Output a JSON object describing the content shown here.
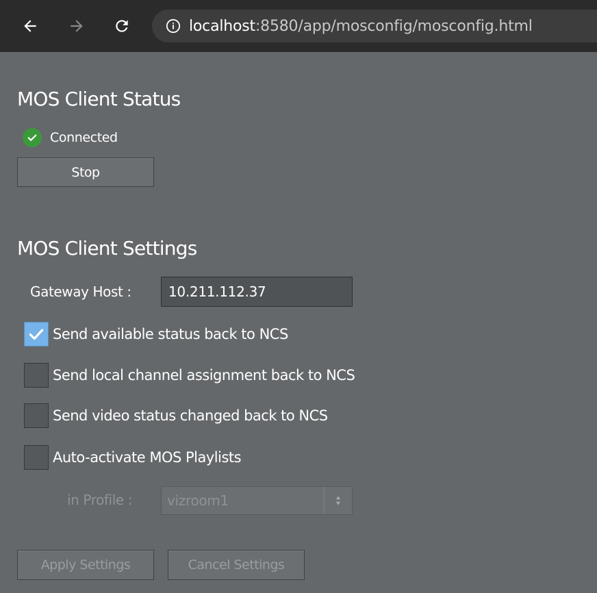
{
  "browser": {
    "url_host": "localhost",
    "url_rest": ":8580/app/mosconfig/mosconfig.html",
    "back_icon": "back-arrow-icon",
    "forward_icon": "forward-arrow-icon",
    "reload_icon": "reload-icon",
    "info_icon": "info-icon"
  },
  "status_section": {
    "title": "MOS Client Status",
    "status_text": "Connected",
    "status_color": "#3a9a3a",
    "stop_label": "Stop"
  },
  "settings_section": {
    "title": "MOS Client Settings",
    "gateway_label": "Gateway Host :",
    "gateway_value": "10.211.112.37",
    "options": [
      {
        "label": "Send available status back to NCS",
        "checked": true
      },
      {
        "label": "Send local channel assignment back to NCS",
        "checked": false
      },
      {
        "label": "Send video status changed back to NCS",
        "checked": false
      },
      {
        "label": "Auto-activate MOS Playlists",
        "checked": false
      }
    ],
    "profile_label": "in Profile :",
    "profile_value": "vizroom1",
    "apply_label": "Apply Settings",
    "cancel_label": "Cancel Settings"
  },
  "colors": {
    "page_background": "#64686b",
    "checkbox_checked": "#75b3ea"
  }
}
